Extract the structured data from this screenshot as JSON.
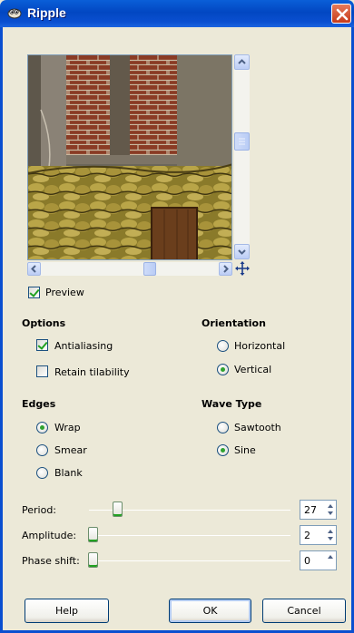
{
  "window": {
    "title": "Ripple"
  },
  "preview": {
    "label": "Preview",
    "checked": true
  },
  "options": {
    "header": "Options",
    "antialiasing": {
      "label": "Antialiasing",
      "checked": true
    },
    "retain_tilability": {
      "label": "Retain tilability",
      "checked": false
    }
  },
  "orientation": {
    "header": "Orientation",
    "options": [
      {
        "label": "Horizontal",
        "selected": false
      },
      {
        "label": "Vertical",
        "selected": true
      }
    ]
  },
  "edges": {
    "header": "Edges",
    "options": [
      {
        "label": "Wrap",
        "selected": true
      },
      {
        "label": "Smear",
        "selected": false
      },
      {
        "label": "Blank",
        "selected": false
      }
    ]
  },
  "wave_type": {
    "header": "Wave Type",
    "options": [
      {
        "label": "Sawtooth",
        "selected": false
      },
      {
        "label": "Sine",
        "selected": true
      }
    ]
  },
  "sliders": {
    "period": {
      "label": "Period:",
      "value": "27"
    },
    "amplitude": {
      "label": "Amplitude:",
      "value": "2"
    },
    "phase_shift": {
      "label": "Phase shift:",
      "value": "0"
    }
  },
  "buttons": {
    "help": "Help",
    "ok": "OK",
    "cancel": "Cancel"
  },
  "colors": {
    "titlebar": "#0a4fd0",
    "dialog_bg": "#ece9d8",
    "accent_green": "#21a121",
    "close_red": "#c73b1b"
  },
  "icons": {
    "app": "gimp-icon",
    "close": "close-icon",
    "navigate": "navigate-icon"
  }
}
